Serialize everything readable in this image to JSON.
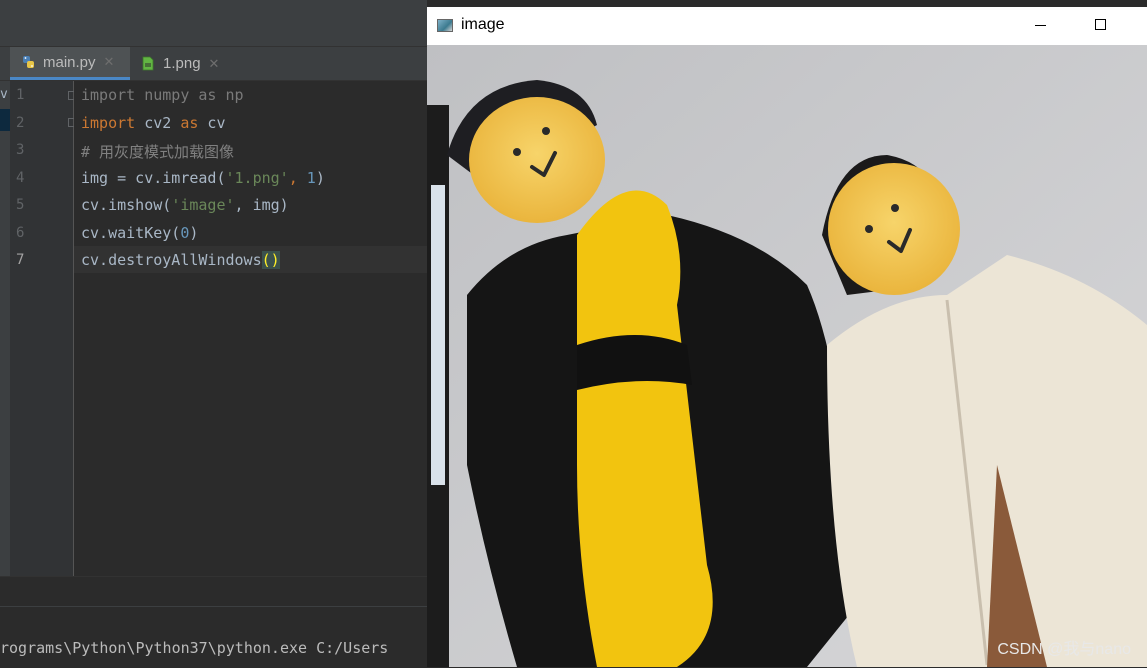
{
  "ide": {
    "tabs": [
      {
        "label": "main.py",
        "active": true,
        "icon": "python-file-icon"
      },
      {
        "label": "1.png",
        "active": false,
        "icon": "image-file-icon"
      }
    ],
    "left_strip_char": "v",
    "line_numbers": [
      "1",
      "2",
      "3",
      "4",
      "5",
      "6",
      "7"
    ],
    "run_output": "rograms\\Python\\Python37\\python.exe C:/Users"
  },
  "code": {
    "l1": {
      "kw": "import",
      "rest": " numpy as np"
    },
    "l2": {
      "kw1": "import",
      "mid": " cv2 ",
      "kw2": "as",
      "end": " cv"
    },
    "l3": {
      "comment": "# 用灰度模式加载图像"
    },
    "l4": {
      "pre": "img = cv.imread(",
      "str": "'1.png'",
      "sep": ", ",
      "num": "1",
      "end": ")"
    },
    "l5": {
      "pre": "cv.imshow(",
      "str": "'image'",
      "end": ", img)"
    },
    "l6": {
      "pre": "cv.waitKey(",
      "num": "0",
      "end": ")"
    },
    "l7": {
      "pre": "cv.destroyAllWindows",
      "paren": "()"
    }
  },
  "image_window": {
    "title": "image",
    "watermark": "CSDN @我与nano"
  },
  "colors": {
    "ide_bg": "#2b2b2b",
    "keyword": "#cc7832",
    "string": "#6a8759",
    "number": "#6897bb",
    "comment": "#808080"
  }
}
